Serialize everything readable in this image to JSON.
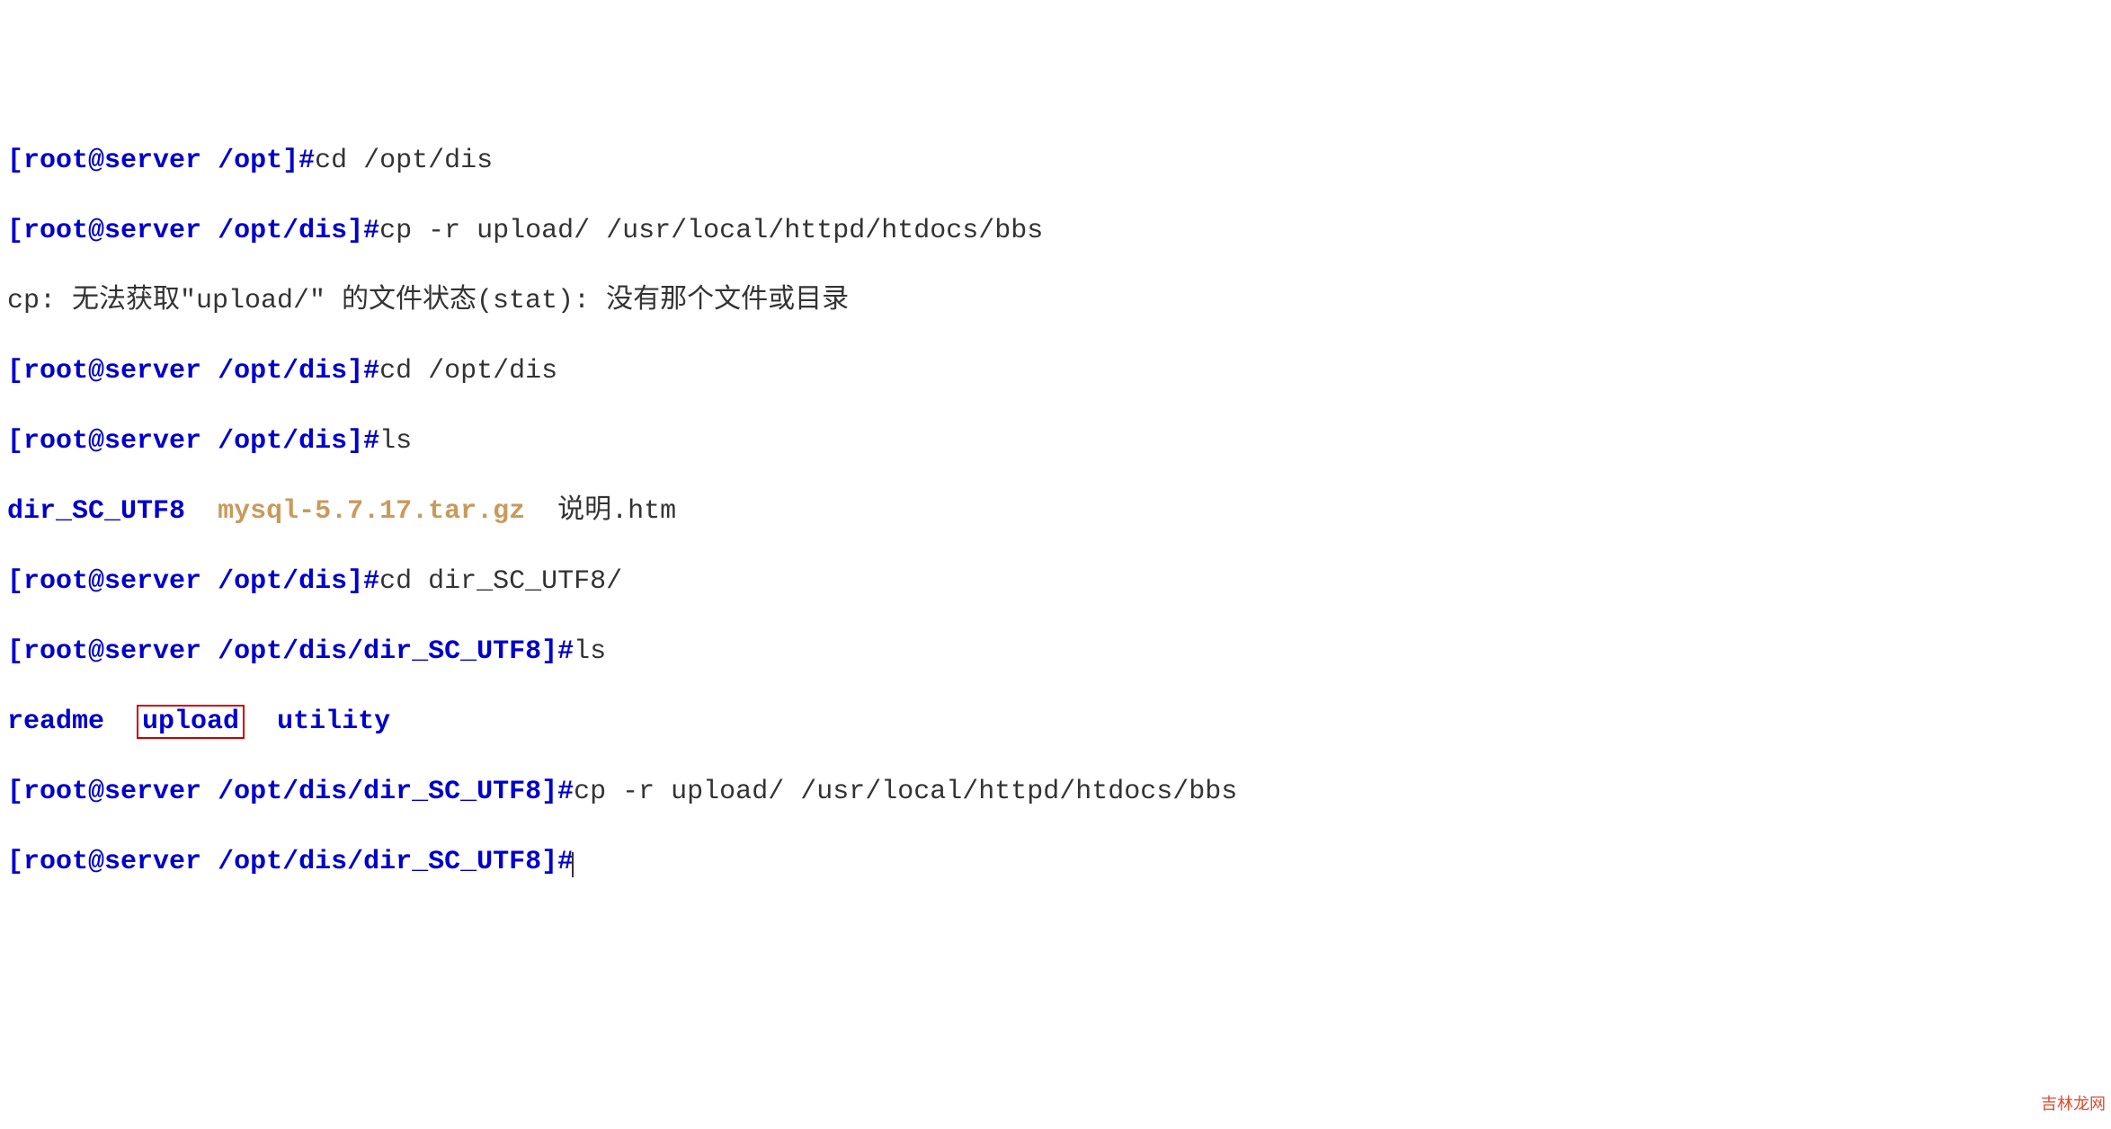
{
  "lines": {
    "l1": {
      "prompt_open": "[",
      "user_host": "root@server",
      "space": " ",
      "path": "/opt",
      "prompt_close": "]#",
      "cmd": "cd /opt/dis"
    },
    "l2": {
      "prompt_open": "[",
      "user_host": "root@server",
      "space": " ",
      "path": "/opt/dis",
      "prompt_close": "]#",
      "cmd": "cp -r upload/ /usr/local/httpd/htdocs/bbs"
    },
    "l3": {
      "output": "cp: 无法获取\"upload/\" 的文件状态(stat): 没有那个文件或目录"
    },
    "l4": {
      "prompt_open": "[",
      "user_host": "root@server",
      "space": " ",
      "path": "/opt/dis",
      "prompt_close": "]#",
      "cmd": "cd /opt/dis"
    },
    "l5": {
      "prompt_open": "[",
      "user_host": "root@server",
      "space": " ",
      "path": "/opt/dis",
      "prompt_close": "]#",
      "cmd": "ls"
    },
    "l6": {
      "dir1": "dir_SC_UTF8",
      "gap1": "  ",
      "file1": "mysql-5.7.17.tar.gz",
      "gap2": "  ",
      "file2": "说明.htm"
    },
    "l7": {
      "prompt_open": "[",
      "user_host": "root@server",
      "space": " ",
      "path": "/opt/dis",
      "prompt_close": "]#",
      "cmd": "cd dir_SC_UTF8/"
    },
    "l8": {
      "prompt_open": "[",
      "user_host": "root@server",
      "space": " ",
      "path": "/opt/dis/dir_SC_UTF8",
      "prompt_close": "]#",
      "cmd": "ls"
    },
    "l9": {
      "dir1": "readme",
      "gap1": "  ",
      "dir2": "upload",
      "gap2": "  ",
      "dir3": "utility"
    },
    "l10": {
      "prompt_open": "[",
      "user_host": "root@server",
      "space": " ",
      "path": "/opt/dis/dir_SC_UTF8",
      "prompt_close": "]#",
      "cmd": "cp -r upload/ /usr/local/httpd/htdocs/bbs"
    },
    "l11": {
      "prompt_open": "[",
      "user_host": "root@server",
      "space": " ",
      "path": "/opt/dis/dir_SC_UTF8",
      "prompt_close": "]#",
      "cmd": ""
    }
  },
  "watermark": "吉林龙网"
}
